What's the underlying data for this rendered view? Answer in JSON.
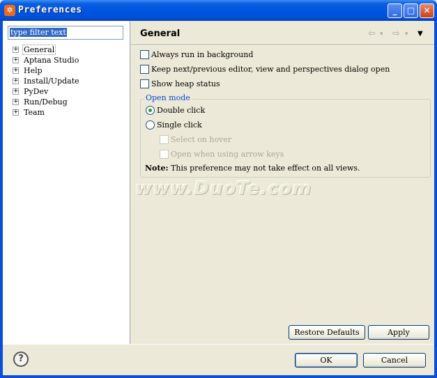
{
  "window": {
    "title": "Preferences",
    "icon": "eclipse-gear-icon",
    "controls": {
      "minimize": "_",
      "maximize": "□",
      "close": "✕"
    }
  },
  "sidebar": {
    "filter": {
      "value": "type filter text"
    },
    "tree": [
      {
        "label": "General",
        "expander": "+",
        "selected": true
      },
      {
        "label": "Aptana Studio",
        "expander": "+"
      },
      {
        "label": "Help",
        "expander": "+"
      },
      {
        "label": "Install/Update",
        "expander": "+"
      },
      {
        "label": "PyDev",
        "expander": "+"
      },
      {
        "label": "Run/Debug",
        "expander": "+"
      },
      {
        "label": "Team",
        "expander": "+"
      }
    ]
  },
  "page": {
    "title": "General",
    "nav": {
      "back": "⇦",
      "forward": "⇨",
      "dropdown": "▾",
      "menu": "▼"
    },
    "options": [
      {
        "label": "Always run in background",
        "checked": false
      },
      {
        "label": "Keep next/previous editor, view and perspectives dialog open",
        "checked": false
      },
      {
        "label": "Show heap status",
        "checked": false
      }
    ],
    "open_mode": {
      "title": "Open mode",
      "radios": [
        {
          "label": "Double click",
          "selected": true
        },
        {
          "label": "Single click",
          "selected": false
        }
      ],
      "sub_options": [
        {
          "label": "Select on hover",
          "checked": false,
          "enabled": false
        },
        {
          "label": "Open when using arrow keys",
          "checked": false,
          "enabled": false
        }
      ]
    },
    "note": {
      "prefix": "Note:",
      "text": " This preference may not take effect on all views."
    },
    "watermark": "www.DuoTe.com",
    "buttons": {
      "restore_defaults": "Restore Defaults",
      "apply": "Apply"
    }
  },
  "footer": {
    "help": "?",
    "ok": "OK",
    "cancel": "Cancel"
  }
}
